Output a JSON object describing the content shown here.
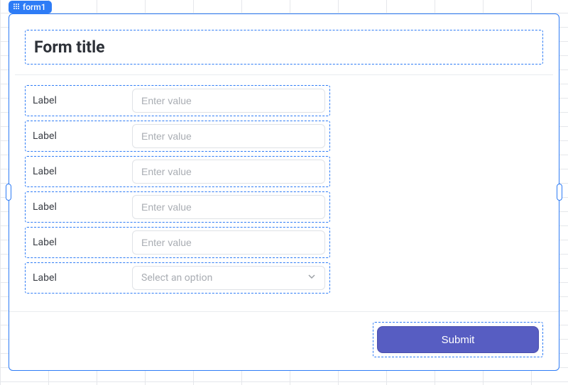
{
  "tag": {
    "label": "form1"
  },
  "title": "Form title",
  "fields": [
    {
      "label": "Label",
      "placeholder": "Enter value",
      "value": ""
    },
    {
      "label": "Label",
      "placeholder": "Enter value",
      "value": ""
    },
    {
      "label": "Label",
      "placeholder": "Enter value",
      "value": ""
    },
    {
      "label": "Label",
      "placeholder": "Enter value",
      "value": ""
    },
    {
      "label": "Label",
      "placeholder": "Enter value",
      "value": ""
    }
  ],
  "select": {
    "label": "Label",
    "placeholder": "Select an option"
  },
  "submit": {
    "label": "Submit"
  },
  "colors": {
    "primary": "#575dc2",
    "selection": "#2e7cf6"
  }
}
